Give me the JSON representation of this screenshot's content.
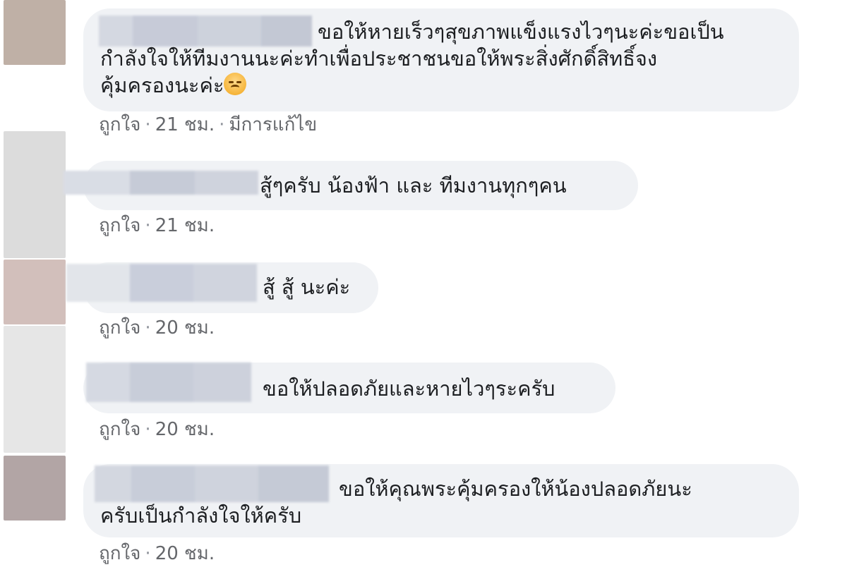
{
  "comments": [
    {
      "text_lines": [
        "ขอให้หายเร็วๆสุขภาพแข็งแรงไวๆนะค่ะขอเป็น",
        "กำลังใจให้ทีมงานนะค่ะทำเพื่อประชาชนขอให้พระสิ่งศักดิ์สิทธิ์จง",
        "คุ้มครองนะค่ะ"
      ],
      "emoji_icon": "worried-face-emoji-icon",
      "like_label": "ถูกใจ",
      "time": "21 ชม.",
      "edited_label": "มีการแก้ไข"
    },
    {
      "text_lines": [
        "สู้ๆครับ น้องฟ้า และ ทีมงานทุกๆคน"
      ],
      "like_label": "ถูกใจ",
      "time": "21 ชม."
    },
    {
      "text_lines": [
        "สู้ สู้ นะค่ะ"
      ],
      "like_label": "ถูกใจ",
      "time": "20 ชม."
    },
    {
      "text_lines": [
        "ขอให้ปลอดภัยและหายไวๆระครับ"
      ],
      "like_label": "ถูกใจ",
      "time": "20 ชม."
    },
    {
      "text_lines": [
        "ขอให้คุณพระคุ้มครองให้น้องปลอดภัยนะ",
        "ครับเป็นกำลังใจให้ครับ"
      ],
      "like_label": "ถูกใจ",
      "time": "20 ชม."
    }
  ],
  "separator": "·",
  "colors": {
    "bubble_bg": "#f0f2f5",
    "text": "#1c1e21",
    "meta_text": "#65676b",
    "blur_name": "#c9ced9"
  }
}
